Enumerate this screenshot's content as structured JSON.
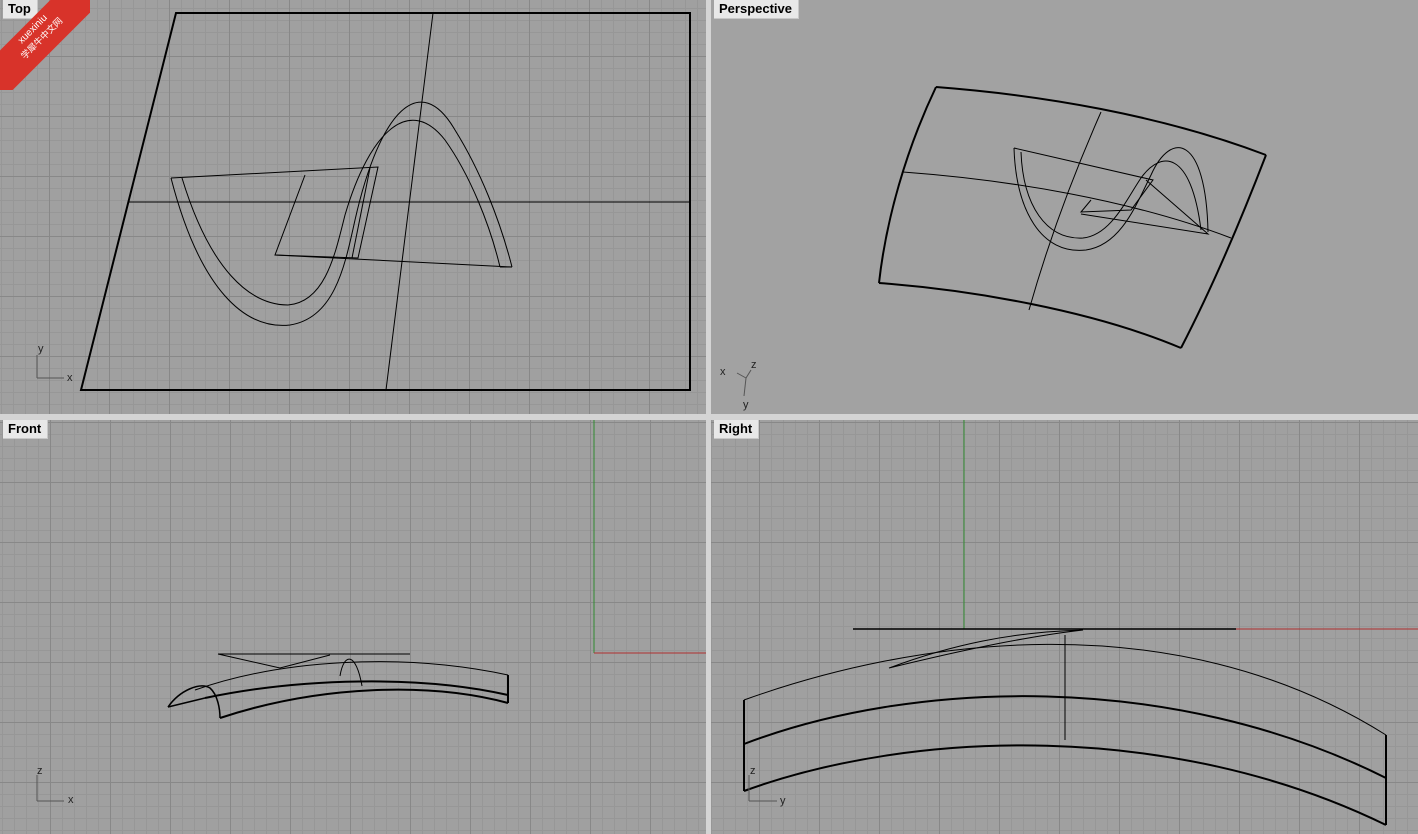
{
  "viewports": {
    "top": {
      "label": "Top"
    },
    "perspective": {
      "label": "Perspective"
    },
    "front": {
      "label": "Front"
    },
    "right": {
      "label": "Right"
    }
  },
  "axes": {
    "top": {
      "horizontal": "x",
      "vertical": "y"
    },
    "perspective": {
      "first": "x",
      "second": "z",
      "third": "y"
    },
    "front": {
      "horizontal": "x",
      "vertical": "z"
    },
    "right": {
      "horizontal": "y",
      "vertical": "z"
    }
  },
  "watermark": {
    "line1": "xuexiniu",
    "line2": "学犀牛中文网"
  },
  "colors": {
    "grid_bg": "#a0a0a0",
    "x_axis": "#b03030",
    "y_axis": "#2f8a2f",
    "curve": "#000000"
  }
}
